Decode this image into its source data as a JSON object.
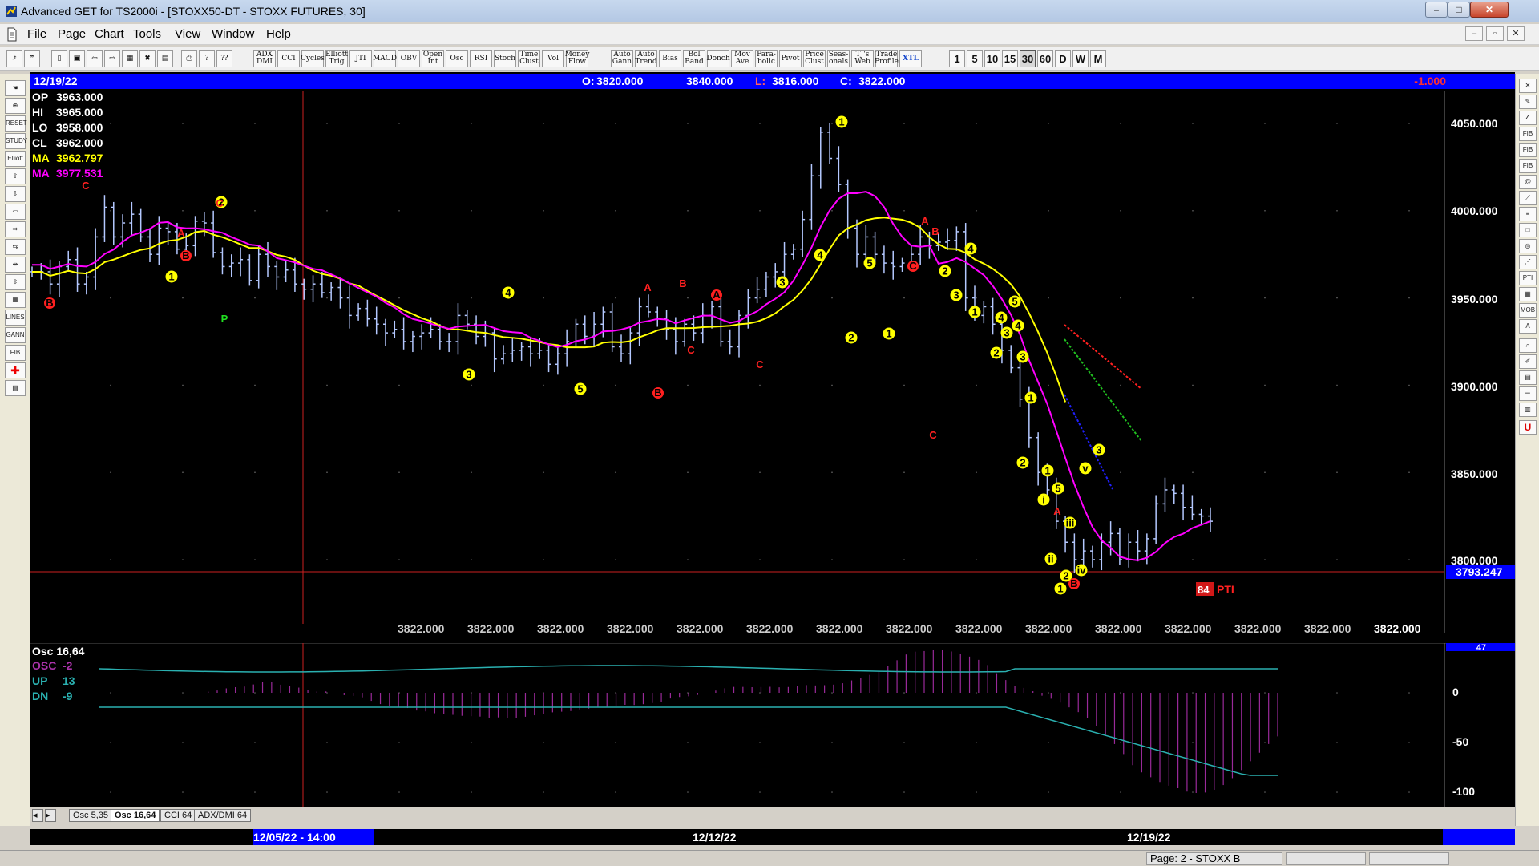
{
  "window": {
    "title": "Advanced GET for TS2000i - [STOXX50-DT - STOXX FUTURES, 30]",
    "buttons": {
      "minimize": "–",
      "maximize": "□",
      "close": "✕"
    }
  },
  "menubar": {
    "items": [
      "File",
      "Page",
      "Chart",
      "Tools",
      "View",
      "Window",
      "Help"
    ],
    "mdi": {
      "minimize": "–",
      "restore": "▫",
      "close": "✕"
    }
  },
  "toolbar": {
    "text_buttons": [
      "ADX DMI",
      "CCI",
      "Cycles",
      "Elliott Trig",
      "JTI",
      "MACD",
      "OBV",
      "Open Int",
      "Osc",
      "RSI",
      "Stoch",
      "Time Clust",
      "Vol",
      "Money Flow",
      "Auto Gann",
      "Auto Trend",
      "Bias",
      "Bol Band",
      "Donch",
      "Mov Ave",
      "Para- bolic",
      "Pivot",
      "Price Clust",
      "Seas- onals",
      "TJ's Web",
      "Trade Profile",
      "XTL"
    ],
    "periods": [
      "1",
      "5",
      "10",
      "15",
      "30",
      "60",
      "D",
      "W",
      "M"
    ],
    "active_period": "30"
  },
  "header": {
    "date": "12/19/22",
    "open_label": "O:",
    "open": "3820.000",
    "high": "3840.000",
    "low_label": "L:",
    "low": "3816.000",
    "close_label": "C:",
    "close": "3822.000",
    "change": "-1.000"
  },
  "data_window": {
    "rows": [
      {
        "label": "OP",
        "value": "3963.000",
        "color": "#ffffff"
      },
      {
        "label": "HI",
        "value": "3965.000",
        "color": "#ffffff"
      },
      {
        "label": "LO",
        "value": "3958.000",
        "color": "#ffffff"
      },
      {
        "label": "CL",
        "value": "3962.000",
        "color": "#ffffff"
      },
      {
        "label": "MA",
        "value": "3962.797",
        "color": "#ffff00"
      },
      {
        "label": "MA",
        "value": "3977.531",
        "color": "#ff00ff"
      }
    ]
  },
  "price_axis": {
    "ticks": [
      "4050.000",
      "4000.000",
      "3950.000",
      "3900.000",
      "3850.000",
      "3800.000"
    ],
    "current_price": "3793.247"
  },
  "bottom_values": [
    "3822.000",
    "3822.000",
    "3822.000",
    "3822.000",
    "3822.000",
    "3822.000",
    "3822.000",
    "3822.000",
    "3822.000",
    "3822.000",
    "3822.000",
    "3822.000",
    "3822.000",
    "3822.000",
    "3822.000"
  ],
  "pti": {
    "value": "84",
    "label": "PTI"
  },
  "wave_labels": {
    "yellow": [
      "1",
      "2",
      "3",
      "4",
      "5",
      "1",
      "2",
      "3",
      "4",
      "5",
      "1",
      "2",
      "3",
      "4",
      "5",
      "2",
      "1",
      "1",
      "2",
      "4",
      "3",
      "3",
      "4",
      "5",
      "1",
      "2",
      "1",
      "i",
      "ii",
      "iii",
      "iv",
      "v",
      "3",
      "4",
      "5",
      "3",
      "4"
    ],
    "red": [
      "C",
      "B",
      "C",
      "A",
      "B",
      "A",
      "B",
      "A",
      "C",
      "C",
      "B",
      "A",
      "B",
      "C",
      "C",
      "A",
      "B"
    ],
    "green": [
      "P"
    ]
  },
  "oscillator": {
    "title": "Osc 16,64",
    "rows": [
      {
        "label": "OSC",
        "value": "-2",
        "color": "#aa33aa"
      },
      {
        "label": "UP",
        "value": "13",
        "color": "#2ab0b0"
      },
      {
        "label": "DN",
        "value": "-9",
        "color": "#2ab0b0"
      }
    ],
    "axis_ticks": [
      "0",
      "-50",
      "-100"
    ],
    "top_value": "47"
  },
  "tabs": [
    "Osc 5,35",
    "Osc 16,64",
    "CCI 64",
    "ADX/DMI 64"
  ],
  "active_tab": "Osc 16,64",
  "time_axis": {
    "labels": [
      "12/05/22 - 14:00",
      "12/12/22",
      "12/19/22"
    ]
  },
  "status": {
    "page": "Page: 2 - STOXX B"
  },
  "colors": {
    "chart_bg": "#000000",
    "bars": "#b4c8ff",
    "ma_fast": "#ffff00",
    "ma_slow": "#ff00ff",
    "header_bar": "#0000ff",
    "wave_yellow": "#ffff00",
    "wave_red": "#ff2020",
    "support_line": "#cc2020"
  },
  "chart_data": {
    "type": "bar",
    "symbol": "STOXX50-DT - STOXX FUTURES, 30",
    "ylim": [
      3770,
      4065
    ],
    "series": [
      {
        "name": "price",
        "values": [
          3965,
          3965,
          3958,
          3968,
          3972,
          3958,
          3962,
          3985,
          4002,
          3985,
          3993,
          3998,
          3985,
          3975,
          3990,
          3988,
          3978,
          3980,
          3994,
          3993,
          3976,
          3968,
          3970,
          3972,
          3960,
          3975,
          3968,
          3962,
          3966,
          3958,
          3955,
          3958,
          3953,
          3956,
          3950,
          3940,
          3944,
          3938,
          3935,
          3930,
          3932,
          3925,
          3928,
          3930,
          3932,
          3925,
          3925,
          3940,
          3935,
          3928,
          3930,
          3915,
          3918,
          3920,
          3922,
          3918,
          3920,
          3912,
          3918,
          3925,
          3935,
          3928,
          3935,
          3942,
          3922,
          3918,
          3930,
          3945,
          3942,
          3938,
          3932,
          3925,
          3935,
          3930,
          3940,
          3945,
          3925,
          3922,
          3940,
          3950,
          3955,
          3962,
          3965,
          3975,
          3978,
          3995,
          4020,
          4045,
          4030,
          4015,
          3990,
          3975,
          3985,
          3975,
          3970,
          3968,
          3970,
          3975,
          3985,
          3980,
          3982,
          3983,
          3988,
          3950,
          3940,
          3945,
          3935,
          3920,
          3910,
          3892,
          3870,
          3850,
          3840,
          3822,
          3810,
          3800,
          3805,
          3800,
          3810,
          3815,
          3800,
          3810,
          3805,
          3812,
          3832,
          3840,
          3838,
          3830,
          3826,
          3825,
          3822
        ]
      },
      {
        "name": "MA",
        "values": [
          3962.797
        ]
      },
      {
        "name": "MA",
        "values": [
          3977.531
        ]
      }
    ]
  }
}
